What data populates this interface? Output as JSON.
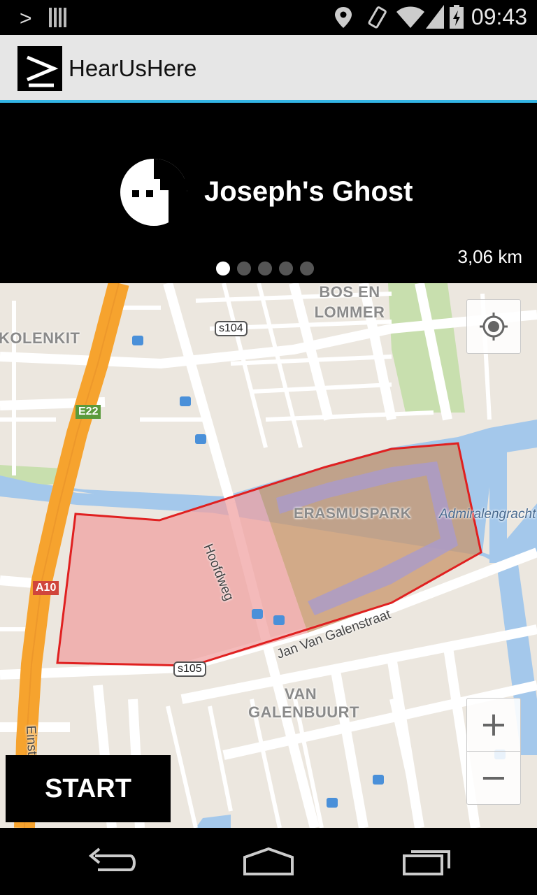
{
  "status_bar": {
    "prompt_glyph": ">",
    "time": "09:43",
    "icons": [
      "terminal-icon",
      "barcode-icon",
      "location-icon",
      "vibrate-icon",
      "wifi-icon",
      "signal-icon",
      "battery-charging-icon"
    ]
  },
  "action_bar": {
    "app_title": "HearUsHere",
    "logo_glyph": ">"
  },
  "header": {
    "walk_title": "Joseph's Ghost",
    "distance": "3,06 km",
    "page_count": 5,
    "active_page": 0
  },
  "map": {
    "district_labels": {
      "bos_en_lommer_1": "BOS EN",
      "bos_en_lommer_2": "LOMMER",
      "kolenkit": "KOLENKIT",
      "erasmuspark": "ERASMUSPARK",
      "van_galenbuurt_1": "VAN",
      "van_galenbuurt_2": "GALENBUURT"
    },
    "road_labels": {
      "hoofdweg": "Hoofdweg",
      "jan_van_galenstraat": "Jan Van Galenstraat",
      "admiralengracht": "Admiralengracht",
      "einst": "Einst"
    },
    "shields": {
      "s104": "s104",
      "s105": "s105",
      "e22": "E22",
      "a10": "A10"
    },
    "colors": {
      "land": "#ece7df",
      "road": "#ffffff",
      "water": "#a4c8eb",
      "park": "#c8dfae",
      "highway": "#f6a32e",
      "area_fill": "#f0a0a0",
      "area_stroke": "#e02020",
      "park_overlay": "#c9956b"
    }
  },
  "controls": {
    "zoom_in": "+",
    "zoom_out": "−",
    "start_label": "START"
  },
  "nav_bar": {
    "icons": [
      "back-icon",
      "home-icon",
      "recent-apps-icon"
    ]
  }
}
